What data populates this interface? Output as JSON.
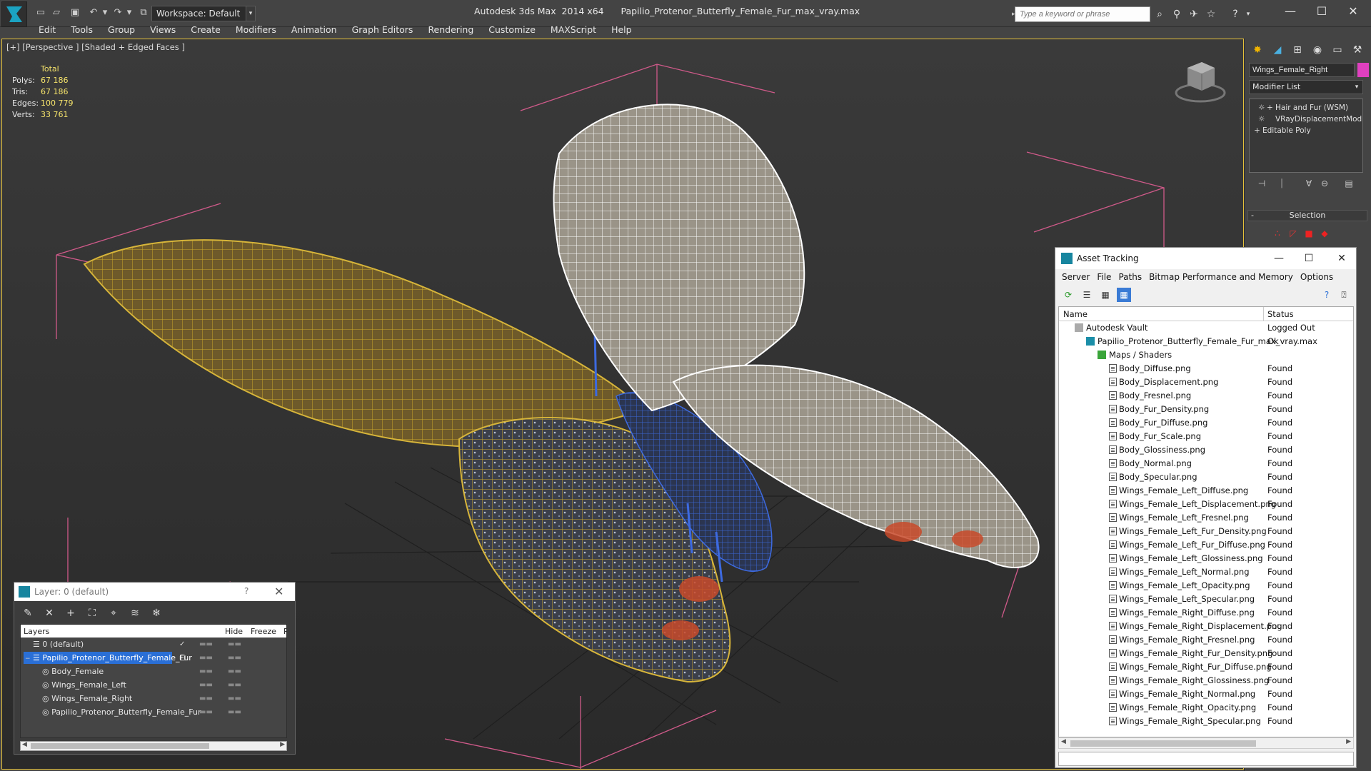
{
  "app": {
    "title": "Autodesk 3ds Max  2014 x64",
    "filename": "Papilio_Protenor_Butterfly_Female_Fur_max_vray.max",
    "workspace": "Workspace: Default",
    "search_placeholder": "Type a keyword or phrase"
  },
  "menu": [
    "Edit",
    "Tools",
    "Group",
    "Views",
    "Create",
    "Modifiers",
    "Animation",
    "Graph Editors",
    "Rendering",
    "Customize",
    "MAXScript",
    "Help"
  ],
  "viewport": {
    "label": "[+] [Perspective ] [Shaded + Edged Faces ]",
    "stats": {
      "header": "Total",
      "rows": [
        {
          "label": "Polys:",
          "value": "67 186"
        },
        {
          "label": "Tris:",
          "value": "67 186"
        },
        {
          "label": "Edges:",
          "value": "100 779"
        },
        {
          "label": "Verts:",
          "value": "33 761"
        }
      ]
    }
  },
  "command_panel": {
    "object_name": "Wings_Female_Right",
    "object_color": "#e040c0",
    "modifier_list": "Modifier List",
    "stack": [
      "Hair and Fur (WSM)",
      "VRayDisplacementMod",
      "Editable Poly"
    ],
    "selection_title": "Selection"
  },
  "asset_tracking": {
    "title": "Asset Tracking",
    "menu": [
      "Server",
      "File",
      "Paths",
      "Bitmap Performance and Memory",
      "Options"
    ],
    "columns": {
      "name": "Name",
      "status": "Status"
    },
    "rows": [
      {
        "name": "Autodesk Vault",
        "status": "Logged Out",
        "level": 0,
        "icon": "vault"
      },
      {
        "name": "Papilio_Protenor_Butterfly_Female_Fur_max_vray.max",
        "status": "Ok",
        "level": 1,
        "icon": "max-file"
      },
      {
        "name": "Maps / Shaders",
        "status": "",
        "level": 2,
        "icon": "folder"
      },
      {
        "name": "Body_Diffuse.png",
        "status": "Found",
        "level": 3,
        "icon": "image-file"
      },
      {
        "name": "Body_Displacement.png",
        "status": "Found",
        "level": 3,
        "icon": "image-file"
      },
      {
        "name": "Body_Fresnel.png",
        "status": "Found",
        "level": 3,
        "icon": "image-file"
      },
      {
        "name": "Body_Fur_Density.png",
        "status": "Found",
        "level": 3,
        "icon": "image-file"
      },
      {
        "name": "Body_Fur_Diffuse.png",
        "status": "Found",
        "level": 3,
        "icon": "image-file"
      },
      {
        "name": "Body_Fur_Scale.png",
        "status": "Found",
        "level": 3,
        "icon": "image-file"
      },
      {
        "name": "Body_Glossiness.png",
        "status": "Found",
        "level": 3,
        "icon": "image-file"
      },
      {
        "name": "Body_Normal.png",
        "status": "Found",
        "level": 3,
        "icon": "image-file"
      },
      {
        "name": "Body_Specular.png",
        "status": "Found",
        "level": 3,
        "icon": "image-file"
      },
      {
        "name": "Wings_Female_Left_Diffuse.png",
        "status": "Found",
        "level": 3,
        "icon": "image-file"
      },
      {
        "name": "Wings_Female_Left_Displacement.png",
        "status": "Found",
        "level": 3,
        "icon": "image-file"
      },
      {
        "name": "Wings_Female_Left_Fresnel.png",
        "status": "Found",
        "level": 3,
        "icon": "image-file"
      },
      {
        "name": "Wings_Female_Left_Fur_Density.png",
        "status": "Found",
        "level": 3,
        "icon": "image-file"
      },
      {
        "name": "Wings_Female_Left_Fur_Diffuse.png",
        "status": "Found",
        "level": 3,
        "icon": "image-file"
      },
      {
        "name": "Wings_Female_Left_Glossiness.png",
        "status": "Found",
        "level": 3,
        "icon": "image-file"
      },
      {
        "name": "Wings_Female_Left_Normal.png",
        "status": "Found",
        "level": 3,
        "icon": "image-file"
      },
      {
        "name": "Wings_Female_Left_Opacity.png",
        "status": "Found",
        "level": 3,
        "icon": "image-file"
      },
      {
        "name": "Wings_Female_Left_Specular.png",
        "status": "Found",
        "level": 3,
        "icon": "image-file"
      },
      {
        "name": "Wings_Female_Right_Diffuse.png",
        "status": "Found",
        "level": 3,
        "icon": "image-file"
      },
      {
        "name": "Wings_Female_Right_Displacement.png",
        "status": "Found",
        "level": 3,
        "icon": "image-file"
      },
      {
        "name": "Wings_Female_Right_Fresnel.png",
        "status": "Found",
        "level": 3,
        "icon": "image-file"
      },
      {
        "name": "Wings_Female_Right_Fur_Density.png",
        "status": "Found",
        "level": 3,
        "icon": "image-file"
      },
      {
        "name": "Wings_Female_Right_Fur_Diffuse.png",
        "status": "Found",
        "level": 3,
        "icon": "image-file"
      },
      {
        "name": "Wings_Female_Right_Glossiness.png",
        "status": "Found",
        "level": 3,
        "icon": "image-file"
      },
      {
        "name": "Wings_Female_Right_Normal.png",
        "status": "Found",
        "level": 3,
        "icon": "image-file"
      },
      {
        "name": "Wings_Female_Right_Opacity.png",
        "status": "Found",
        "level": 3,
        "icon": "image-file"
      },
      {
        "name": "Wings_Female_Right_Specular.png",
        "status": "Found",
        "level": 3,
        "icon": "image-file"
      }
    ]
  },
  "layer_window": {
    "title": "Layer: 0 (default)",
    "help": "?",
    "columns": {
      "layers": "Layers",
      "hide": "Hide",
      "freeze": "Freeze",
      "render": "R"
    },
    "rows": [
      {
        "name": "0 (default)",
        "level": 0,
        "selected": false,
        "kind": "layer",
        "current": true
      },
      {
        "name": "Papilio_Protenor_Butterfly_Female_Fur",
        "level": 0,
        "selected": true,
        "kind": "layer",
        "current": false
      },
      {
        "name": "Body_Female",
        "level": 1,
        "selected": false,
        "kind": "object",
        "current": false
      },
      {
        "name": "Wings_Female_Left",
        "level": 1,
        "selected": false,
        "kind": "object",
        "current": false
      },
      {
        "name": "Wings_Female_Right",
        "level": 1,
        "selected": false,
        "kind": "object",
        "current": false
      },
      {
        "name": "Papilio_Protenor_Butterfly_Female_Fur",
        "level": 1,
        "selected": false,
        "kind": "object",
        "current": false
      }
    ]
  },
  "colors": {
    "viewport_border": "#e6c23a",
    "stats_value": "#f5e36b",
    "selection_blue": "#2a6fd6",
    "accent_teal": "#17859f"
  }
}
